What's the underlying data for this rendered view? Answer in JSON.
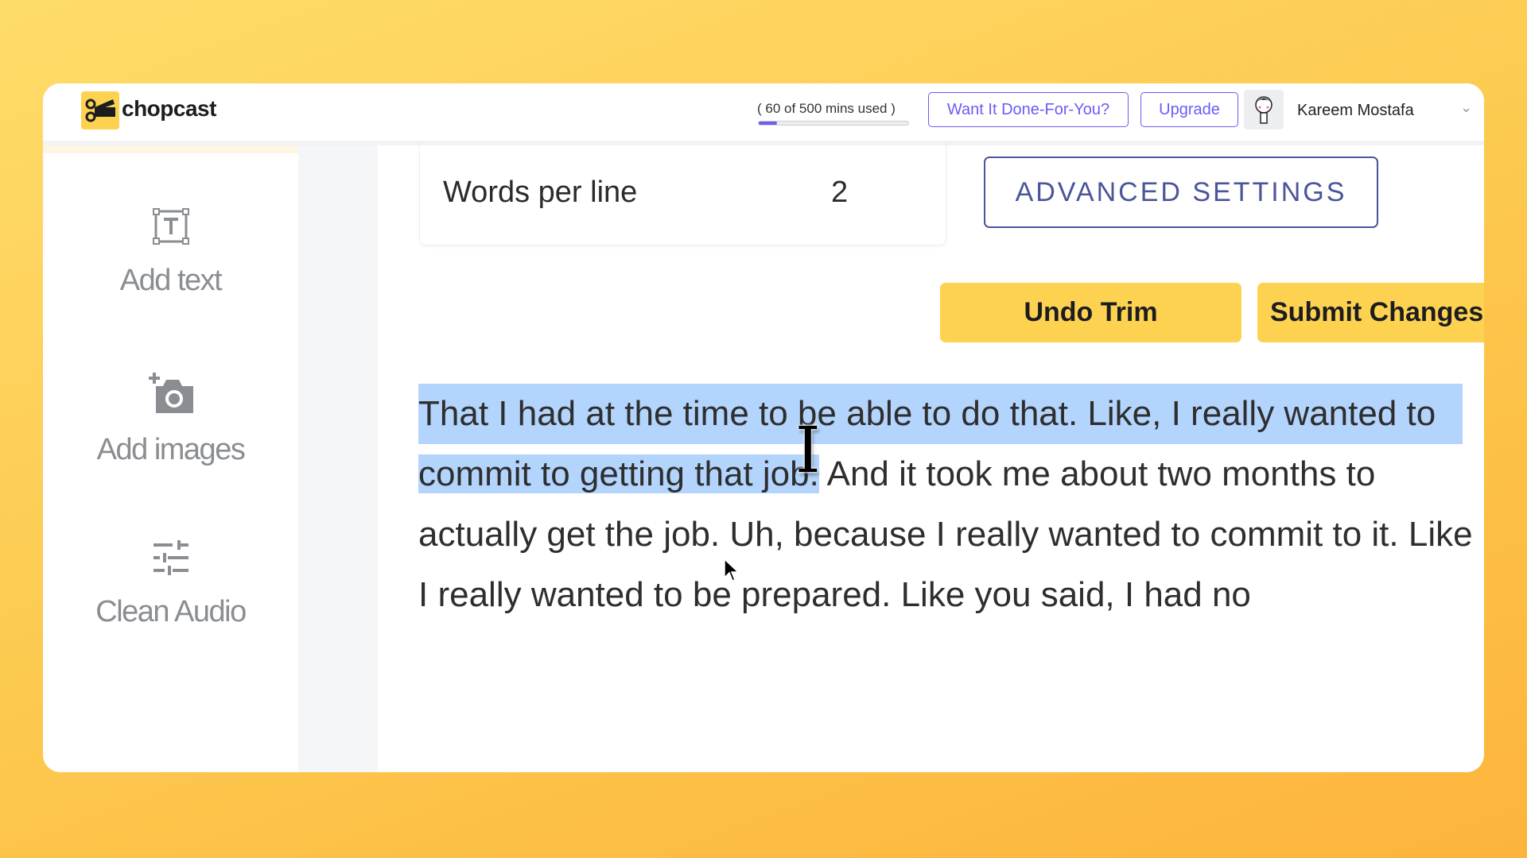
{
  "app": {
    "name": "chopcast",
    "logo_icon": "scissors-clapper-icon",
    "brand_color": "#fdd251",
    "accent_color": "#6b5cf5"
  },
  "header": {
    "usage_text": "( 60 of 500 mins used )",
    "usage_fraction": 0.12,
    "done_for_you_label": "Want It Done-For-You?",
    "upgrade_label": "Upgrade",
    "user_name": "Kareem Mostafa"
  },
  "sidebar": {
    "items": [
      {
        "label": "Add text",
        "icon": "text-box-icon"
      },
      {
        "label": "Add images",
        "icon": "add-photo-icon"
      },
      {
        "label": "Clean Audio",
        "icon": "sliders-icon"
      }
    ]
  },
  "settings": {
    "words_per_line_label": "Words per line",
    "words_per_line_value": "2",
    "advanced_label": "ADVANCED SETTINGS"
  },
  "actions": {
    "undo_trim_label": "Undo Trim",
    "submit_label": "Submit Changes"
  },
  "transcript": {
    "lines": [
      "That I had at the time to be able to do that. Like, I really wanted to",
      "commit to getting that job.",
      " And it took me about two months to",
      "actually get the job. Uh, because I really wanted to commit to it. Like",
      "I really wanted to be prepared. Like you said, I had no"
    ],
    "selection_color": "#b3d4fc"
  }
}
